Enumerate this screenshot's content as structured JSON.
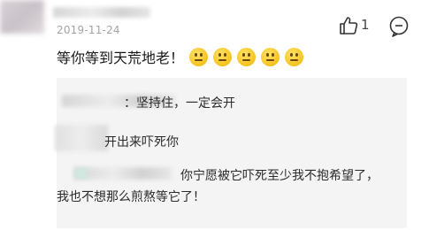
{
  "comment": {
    "timestamp": "2019-11-24",
    "text": "等你等到天荒地老！",
    "emojis": [
      "neutral-face-icon",
      "neutral-face-icon",
      "neutral-face-icon",
      "neutral-face-icon",
      "neutral-face-icon"
    ],
    "like_count": "1"
  },
  "replies": [
    {
      "text": "：坚持住，一定会开"
    },
    {
      "text": "开出来吓死你"
    },
    {
      "text_line1": "你宁愿被它吓死至少我不抱希望了，",
      "text_line2": "我也不想那么煎熬等它了！"
    }
  ],
  "colors": {
    "timestamp": "#a3a3a3",
    "reply_bg": "#f4f4f4",
    "emoji": "#f5c21b"
  }
}
